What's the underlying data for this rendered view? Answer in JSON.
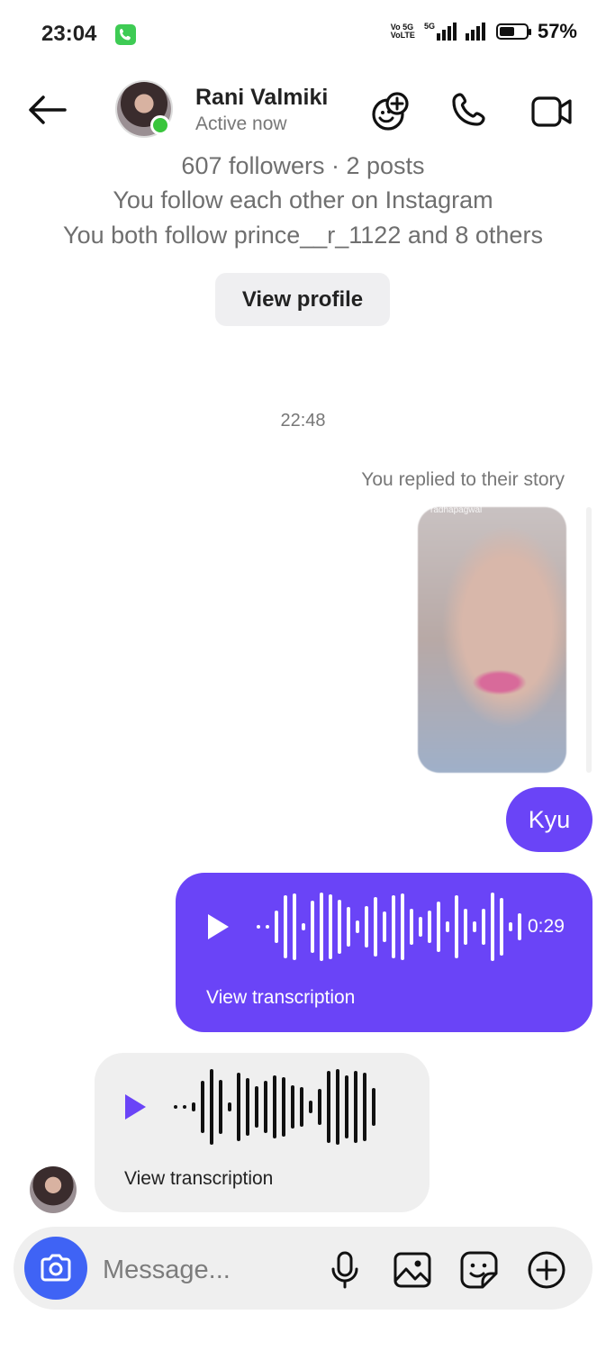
{
  "status_bar": {
    "time": "23:04",
    "net_top": "Vo 5G",
    "net_bottom": "VoLTE",
    "net_type": "5G",
    "battery": "57%",
    "battery_level": 0.57
  },
  "header": {
    "name": "Rani Valmiki",
    "status": "Active now",
    "icons": [
      "back-arrow-icon",
      "add-emoji-icon",
      "phone-icon",
      "video-call-icon"
    ]
  },
  "profile_info": {
    "stats": "607 followers · 2 posts",
    "mutual": "You follow each other on Instagram",
    "follows": "You both follow prince__r_1122 and 8 others",
    "button": "View profile"
  },
  "conversation": {
    "timestamp": "22:48",
    "story_reply_label": "You replied to their story",
    "story_tag": "radhapagwal",
    "sent_text": "Kyu",
    "sent_voice": {
      "duration": "0:29",
      "transcription": "View transcription"
    },
    "received_voice": {
      "transcription": "View transcription"
    }
  },
  "composer": {
    "placeholder": "Message...",
    "icons": [
      "camera-icon",
      "microphone-icon",
      "gallery-icon",
      "sticker-icon",
      "plus-icon"
    ]
  },
  "colors": {
    "accent": "#6a44f7",
    "camera": "#3f63f5",
    "online": "#39c53c"
  }
}
